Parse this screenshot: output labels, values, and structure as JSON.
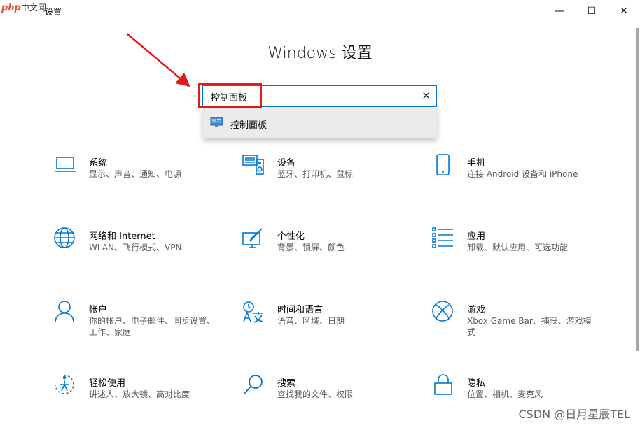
{
  "watermark_logo": {
    "php": "php",
    "cn": "中文网"
  },
  "window": {
    "title": "设置",
    "minimize": "—",
    "maximize": "☐",
    "close": "✕"
  },
  "heading": "Windows 设置",
  "search": {
    "value": "控制面板",
    "clear": "✕"
  },
  "suggestion": {
    "label": "控制面板",
    "icon": "control-panel-icon"
  },
  "tiles": [
    {
      "title": "系统",
      "desc": "显示、声音、通知、电源",
      "icon": "laptop-icon"
    },
    {
      "title": "设备",
      "desc": "蓝牙、打印机、鼠标",
      "icon": "keyboard-speaker-icon"
    },
    {
      "title": "手机",
      "desc": "连接 Android 设备和 iPhone",
      "icon": "phone-icon"
    },
    {
      "title": "网络和 Internet",
      "desc": "WLAN、飞行模式、VPN",
      "icon": "globe-icon"
    },
    {
      "title": "个性化",
      "desc": "背景、锁屏、颜色",
      "icon": "paint-icon"
    },
    {
      "title": "应用",
      "desc": "卸载、默认应用、可选功能",
      "icon": "apps-list-icon"
    },
    {
      "title": "帐户",
      "desc": "你的帐户、电子邮件、同步设置、工作、家庭",
      "icon": "person-icon"
    },
    {
      "title": "时间和语言",
      "desc": "语音、区域、日期",
      "icon": "time-language-icon"
    },
    {
      "title": "游戏",
      "desc": "Xbox Game Bar、捕获、游戏模式",
      "icon": "xbox-icon"
    },
    {
      "title": "轻松使用",
      "desc": "讲述人、放大镜、高对比度",
      "icon": "ease-of-access-icon"
    },
    {
      "title": "搜索",
      "desc": "查找我的文件、权限",
      "icon": "magnifier-icon"
    },
    {
      "title": "隐私",
      "desc": "位置、相机、麦克风",
      "icon": "lock-icon"
    }
  ],
  "footer_watermark": "CSDN @日月星辰TEL",
  "colors": {
    "accent": "#0078d7",
    "annotation": "#e01b1b"
  }
}
